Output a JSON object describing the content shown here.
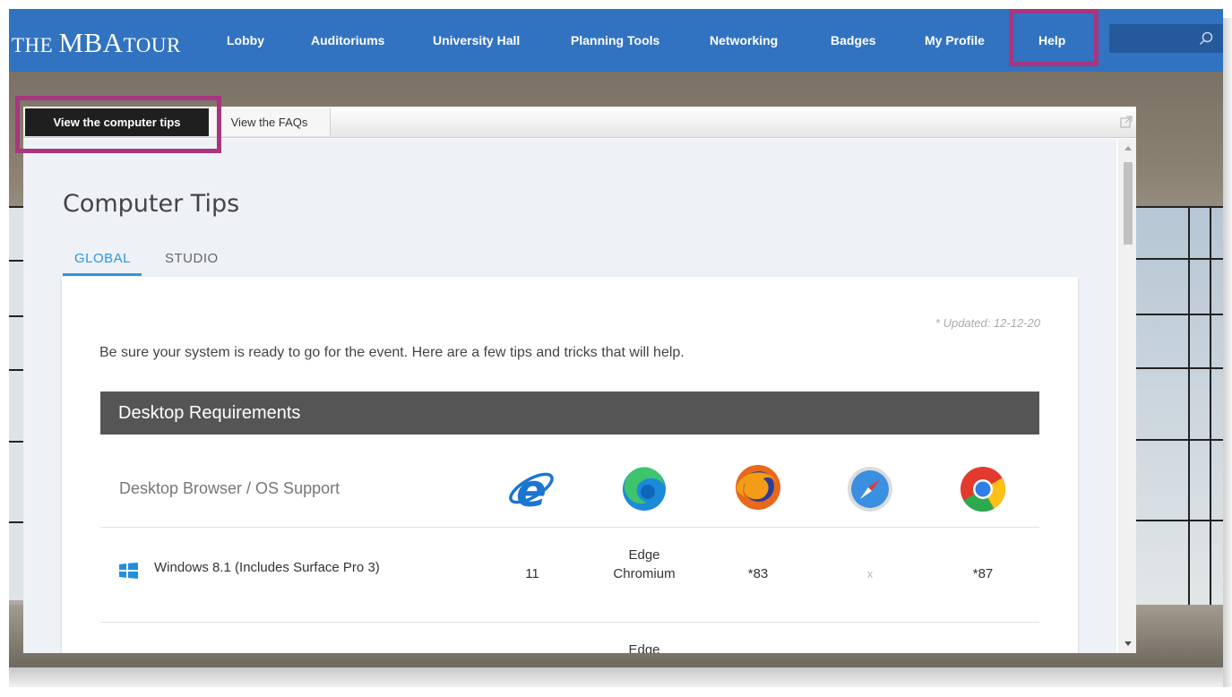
{
  "app": {
    "logo_the": "THE ",
    "logo_mba": "MBA",
    "logo_tour": "TOUR"
  },
  "nav": {
    "items": [
      "Lobby",
      "Auditoriums",
      "University Hall",
      "Planning Tools",
      "Networking",
      "Badges",
      "My Profile",
      "Help"
    ],
    "search_placeholder": "",
    "search_icon": "search-icon",
    "brand_color": "#3173c0",
    "highlight_color": "#a8357f"
  },
  "panel": {
    "tabs": [
      "View the computer tips",
      "View the FAQs"
    ],
    "active_tab": "View the computer tips",
    "title": "Computer Tips",
    "sub_tabs": [
      "GLOBAL",
      "STUDIO"
    ],
    "active_sub_tab": "GLOBAL",
    "updated": "* Updated: 12-12-20",
    "intro": "Be sure your system is ready to go for the event. Here are a few tips and tricks that will help.",
    "section_title": "Desktop Requirements",
    "support_label": "Desktop Browser / OS Support",
    "browsers": [
      "internet-explorer-icon",
      "edge-icon",
      "firefox-icon",
      "safari-icon",
      "chrome-icon"
    ],
    "rows": [
      {
        "os": "Windows 8.1 (Includes Surface Pro 3)",
        "os_icon": "windows-icon",
        "values": [
          "11",
          "Edge Chromium",
          "*83",
          "x",
          "*87"
        ]
      },
      {
        "os": "",
        "os_icon": "windows-icon",
        "values": [
          "",
          "Edge",
          "",
          "",
          ""
        ]
      }
    ]
  }
}
